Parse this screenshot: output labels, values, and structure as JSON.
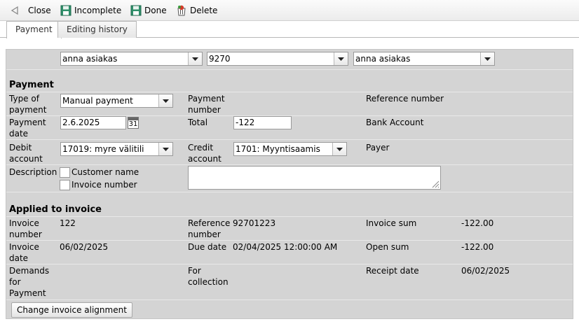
{
  "toolbar": {
    "close_label": "Close",
    "incomplete_label": "Incomplete",
    "done_label": "Done",
    "delete_label": "Delete"
  },
  "tabs": [
    {
      "label": "Payment",
      "active": true
    },
    {
      "label": "Editing history",
      "active": false
    }
  ],
  "top_selects": [
    "anna asiakas",
    "9270",
    "anna asiakas"
  ],
  "payment": {
    "heading": "Payment",
    "type_label": "Type of payment",
    "type_value": "Manual payment",
    "number_label": "Payment number",
    "reference_label": "Reference number",
    "date_label": "Payment date",
    "date_value": "2.6.2025",
    "calendar_day": "31",
    "total_label": "Total",
    "total_value": "-122",
    "bank_account_label": "Bank Account",
    "debit_label": "Debit account",
    "debit_value": "17019: myre välitili",
    "credit_label": "Credit account",
    "credit_value": "1701: Myyntisaamis",
    "payer_label": "Payer",
    "description_label": "Description",
    "customer_name_label": "Customer name",
    "invoice_number_label": "Invoice number"
  },
  "applied": {
    "heading": "Applied to invoice",
    "invoice_number_label": "Invoice number",
    "invoice_number_value": "122",
    "reference_label": "Reference number",
    "reference_value": "92701223",
    "invoice_sum_label": "Invoice sum",
    "invoice_sum_value": "-122.00",
    "invoice_date_label": "Invoice date",
    "invoice_date_value": "06/02/2025",
    "due_date_label": "Due date",
    "due_date_value": "02/04/2025 12:00:00 AM",
    "open_sum_label": "Open sum",
    "open_sum_value": "-122.00",
    "demands_label": "Demands for Payment",
    "for_collection_label": "For collection",
    "receipt_date_label": "Receipt date",
    "receipt_date_value": "06/02/2025",
    "change_alignment_label": "Change invoice alignment"
  },
  "colors": {
    "panel_bg": "#d4d4d4",
    "save_icon": "#2f8f6a",
    "delete_icon": "#d23b2a"
  }
}
